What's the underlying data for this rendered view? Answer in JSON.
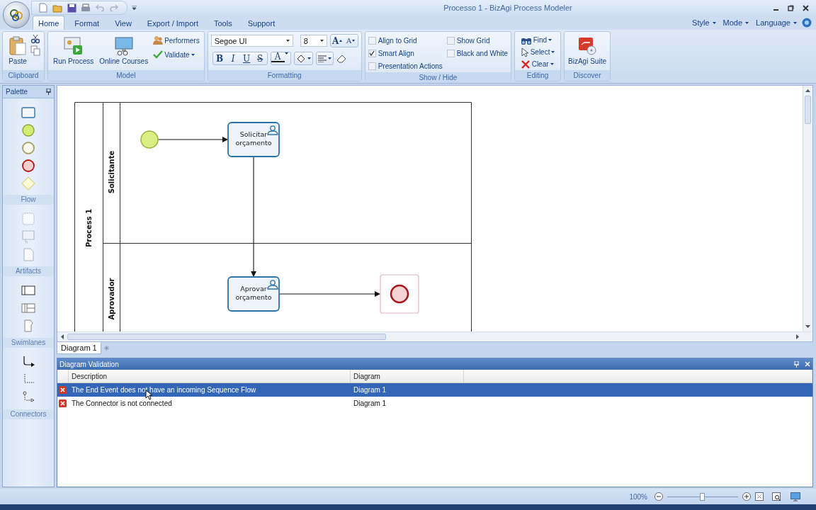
{
  "window": {
    "title": "Processo 1 - BizAgi Process Modeler"
  },
  "ribbon_tabs": [
    {
      "label": "Home",
      "selected": true
    },
    {
      "label": "Format",
      "selected": false
    },
    {
      "label": "View",
      "selected": false
    },
    {
      "label": "Export / Import",
      "selected": false
    },
    {
      "label": "Tools",
      "selected": false
    },
    {
      "label": "Support",
      "selected": false
    }
  ],
  "ribbon_menus": [
    "Style",
    "Mode",
    "Language"
  ],
  "clipboard": {
    "label": "Clipboard",
    "paste": "Paste"
  },
  "model": {
    "label": "Model",
    "run_process": "Run Process",
    "online_courses": "Online Courses",
    "performers": "Performers",
    "validate": "Validate"
  },
  "formatting": {
    "label": "Formatting",
    "font": "Segoe UI",
    "size": "8",
    "grow_font": "A",
    "shrink_font": "A",
    "styles": [
      "B",
      "I",
      "U",
      "S"
    ],
    "font_color": "A"
  },
  "show_hide": {
    "label": "Show / Hide",
    "options": [
      {
        "label": "Align to Grid",
        "checked": false
      },
      {
        "label": "Smart Align",
        "checked": true
      },
      {
        "label": "Presentation Actions",
        "checked": false
      },
      {
        "label": "Show Grid",
        "checked": false
      },
      {
        "label": "Black and White",
        "checked": false
      }
    ]
  },
  "editing": {
    "label": "Editing",
    "actions": [
      "Find",
      "Select",
      "Clear"
    ]
  },
  "discover": {
    "label": "Discover",
    "suite": "BizAgi Suite"
  },
  "palette": {
    "title": "Palette",
    "sections": [
      {
        "label": "Flow",
        "tools": [
          {
            "kind": "task"
          },
          {
            "kind": "start-event"
          },
          {
            "kind": "intermediate-event"
          },
          {
            "kind": "end-event"
          },
          {
            "kind": "gateway"
          }
        ]
      },
      {
        "label": "Artifacts",
        "tools": [
          {
            "kind": "group"
          },
          {
            "kind": "annotation"
          },
          {
            "kind": "data-object"
          }
        ]
      },
      {
        "label": "Swimlanes",
        "tools": [
          {
            "kind": "pool"
          },
          {
            "kind": "lanes"
          },
          {
            "kind": "milestone"
          }
        ]
      },
      {
        "label": "Connectors",
        "tools": [
          {
            "kind": "sequence-flow"
          },
          {
            "kind": "association"
          },
          {
            "kind": "message-flow"
          }
        ]
      }
    ]
  },
  "diagram": {
    "pool": "Process 1",
    "lanes": [
      "Solicitante",
      "Aprovador"
    ],
    "elements": [
      {
        "kind": "start-event",
        "selected": false
      },
      {
        "kind": "task",
        "label": "Solicitar orçamento",
        "selected": false
      },
      {
        "kind": "task",
        "label": "Aprovar orçamento",
        "selected": false
      },
      {
        "kind": "end-event",
        "selected": true
      }
    ]
  },
  "diagram_tabs": [
    {
      "label": "Diagram 1",
      "selected": true
    }
  ],
  "validation": {
    "title": "Diagram Validation",
    "columns": [
      "Description",
      "Diagram"
    ],
    "rows": [
      {
        "description": "The End Event does not have an incoming Sequence Flow",
        "diagram": "Diagram 1",
        "selected": true
      },
      {
        "description": "The Connector is not connected",
        "diagram": "Diagram 1",
        "selected": false
      }
    ]
  },
  "status_bar": {
    "zoom": "100%",
    "level": 0.5
  }
}
